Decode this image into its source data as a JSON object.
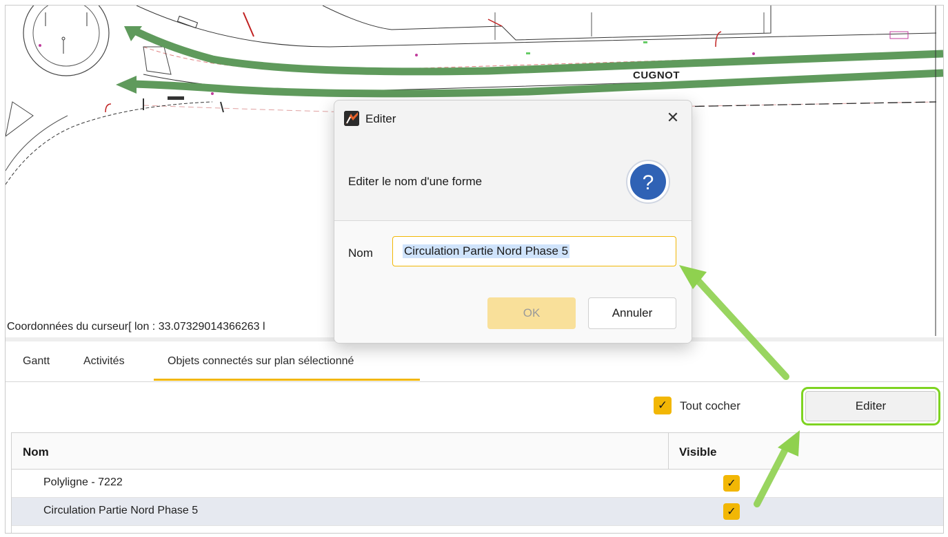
{
  "map": {
    "street_label": "CUGNOT",
    "cursor_coords": "Coordonnées du curseur[ lon : 33.07329014366263 l"
  },
  "tabs": [
    {
      "label": "Gantt"
    },
    {
      "label": "Activités"
    },
    {
      "label": "Objets connectés sur plan sélectionné",
      "active": true
    }
  ],
  "toolbar": {
    "check_all_label": "Tout cocher",
    "check_all_checked": true,
    "edit_label": "Editer"
  },
  "table": {
    "columns": [
      "Nom",
      "Visible"
    ],
    "rows": [
      {
        "name": "Polyligne - 7222",
        "visible": true,
        "selected": false
      },
      {
        "name": "Circulation Partie Nord Phase 5",
        "visible": true,
        "selected": true
      }
    ]
  },
  "dialog": {
    "title": "Editer",
    "message": "Editer le nom d'une forme",
    "name_label": "Nom",
    "name_value": "Circulation Partie Nord Phase 5",
    "ok_label": "OK",
    "cancel_label": "Annuler",
    "icon": "question-icon",
    "close_icon": "close-icon"
  },
  "colors": {
    "accent": "#f2b705",
    "highlight": "#7ed321",
    "route": "#5f9a5c"
  }
}
